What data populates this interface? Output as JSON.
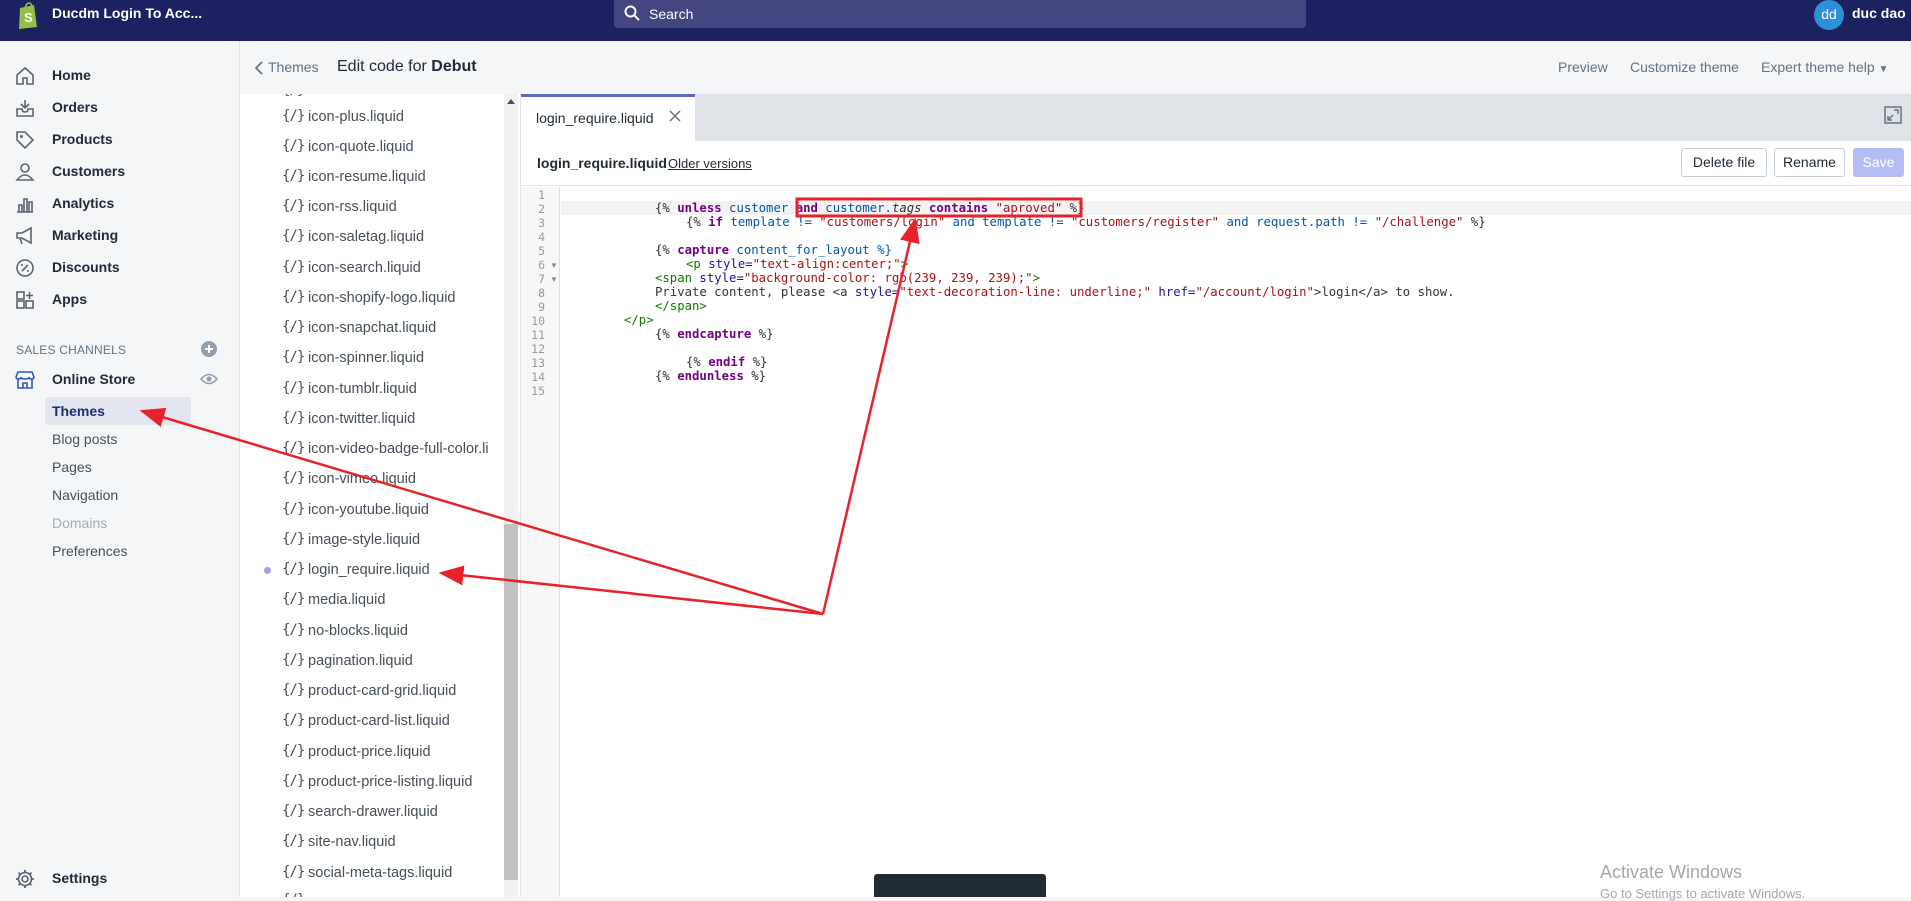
{
  "topbar": {
    "store_name": "Ducdm Login To Acc...",
    "search_placeholder": "Search",
    "avatar_initials": "dd",
    "user_name": "duc dao",
    "bg_color": "#1c2260"
  },
  "nav": {
    "items": [
      {
        "label": "Home",
        "icon": "home-icon"
      },
      {
        "label": "Orders",
        "icon": "orders-icon"
      },
      {
        "label": "Products",
        "icon": "tag-icon"
      },
      {
        "label": "Customers",
        "icon": "user-icon"
      },
      {
        "label": "Analytics",
        "icon": "bar-chart-icon"
      },
      {
        "label": "Marketing",
        "icon": "megaphone-icon"
      },
      {
        "label": "Discounts",
        "icon": "discount-icon"
      },
      {
        "label": "Apps",
        "icon": "apps-icon"
      }
    ],
    "sales_channels_label": "SALES CHANNELS",
    "online_store_label": "Online Store",
    "sub_items": [
      {
        "label": "Themes",
        "state": "active"
      },
      {
        "label": "Blog posts",
        "state": "normal"
      },
      {
        "label": "Pages",
        "state": "normal"
      },
      {
        "label": "Navigation",
        "state": "normal"
      },
      {
        "label": "Domains",
        "state": "disabled"
      },
      {
        "label": "Preferences",
        "state": "normal"
      }
    ],
    "settings_label": "Settings"
  },
  "header": {
    "back_label": "Themes",
    "edit_prefix": "Edit code for",
    "theme_name": "Debut",
    "preview": "Preview",
    "customize": "Customize theme",
    "expert_help": "Expert theme help"
  },
  "files": {
    "icon_glyph": "{/}",
    "names": [
      "icon-plus.liquid",
      "icon-quote.liquid",
      "icon-resume.liquid",
      "icon-rss.liquid",
      "icon-saletag.liquid",
      "icon-search.liquid",
      "icon-shopify-logo.liquid",
      "icon-snapchat.liquid",
      "icon-spinner.liquid",
      "icon-tumblr.liquid",
      "icon-twitter.liquid",
      "icon-video-badge-full-color.li",
      "icon-vimeo.liquid",
      "icon-youtube.liquid",
      "image-style.liquid",
      "login_require.liquid",
      "media.liquid",
      "no-blocks.liquid",
      "pagination.liquid",
      "product-card-grid.liquid",
      "product-card-list.liquid",
      "product-price.liquid",
      "product-price-listing.liquid",
      "search-drawer.liquid",
      "site-nav.liquid",
      "social-meta-tags.liquid"
    ],
    "modified_file": "login_require.liquid"
  },
  "editor": {
    "tab_label": "login_require.liquid",
    "file_title": "login_require.liquid",
    "older_versions": "Older versions",
    "delete_label": "Delete file",
    "rename_label": "Rename",
    "save_label": "Save",
    "line_numbers": [
      "1",
      "2",
      "3",
      "4",
      "5",
      "6",
      "7",
      "8",
      "9",
      "10",
      "11",
      "12",
      "13",
      "14",
      "15"
    ],
    "code": {
      "l2a": "{% ",
      "l2b": "unless",
      "l2c": " customer ",
      "l2d": "and",
      "l2e": " customer.",
      "l2f": "tags",
      "l2g": " ",
      "l2h": "contains",
      "l2i": " \"aproved\"",
      "l2j": " %}",
      "l3a": "{% ",
      "l3b": "if",
      "l3c": " template != ",
      "l3d": "\"customers/login\"",
      "l3e": " and template != ",
      "l3f": "\"customers/register\"",
      "l3g": " and request.path != ",
      "l3h": "\"/challenge\"",
      "l3i": " %}",
      "l5a": "{% ",
      "l5b": "capture",
      "l5c": " content_for_layout %}",
      "l6a": "<p ",
      "l6b": "style=",
      "l6c": "\"text-align:center;\"",
      "l6d": ">",
      "l7a": "<span ",
      "l7b": "style=",
      "l7c": "\"background-color: rgb(239, 239, 239);\"",
      "l7d": ">",
      "l8a": "Private content, please <a ",
      "l8b": "style=",
      "l8c": "\"text-decoration-line: underline;\"",
      "l8d": " href=",
      "l8e": "\"/account/login\"",
      "l8f": ">login</a> to show.",
      "l9": "</span>",
      "l10": "</p>",
      "l11a": "{% ",
      "l11b": "endcapture",
      "l11c": " %}",
      "l13a": "{% ",
      "l13b": "endif",
      "l13c": " %}",
      "l14a": "{% ",
      "l14b": "endunless",
      "l14c": " %}"
    }
  },
  "watermark": {
    "title": "Activate Windows",
    "subtitle": "Go to Settings to activate Windows."
  },
  "annotation_color": "#e8222b"
}
